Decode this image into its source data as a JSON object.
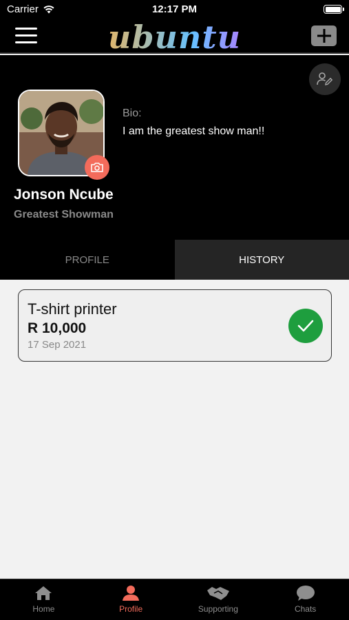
{
  "status_bar": {
    "carrier": "Carrier",
    "time": "12:17 PM"
  },
  "nav": {
    "logo": "ubuntu"
  },
  "profile": {
    "bio_label": "Bio:",
    "bio": "I am the greatest show man!!",
    "name": "Jonson Ncube",
    "title": "Greatest Showman"
  },
  "tabs": [
    {
      "label": "PROFILE",
      "active": false
    },
    {
      "label": "HISTORY",
      "active": true
    }
  ],
  "history": [
    {
      "title": "T-shirt printer",
      "amount": "R 10,000",
      "date": "17 Sep 2021",
      "status": "completed",
      "status_color": "#1e9e3e"
    }
  ],
  "tab_bar": [
    {
      "label": "Home",
      "icon": "home-icon",
      "active": false
    },
    {
      "label": "Profile",
      "icon": "person-icon",
      "active": true
    },
    {
      "label": "Supporting",
      "icon": "handshake-icon",
      "active": false
    },
    {
      "label": "Chats",
      "icon": "chat-icon",
      "active": false
    }
  ],
  "colors": {
    "accent": "#f36b5b",
    "success": "#1e9e3e",
    "background": "#f2f2f2",
    "header": "#000000"
  }
}
